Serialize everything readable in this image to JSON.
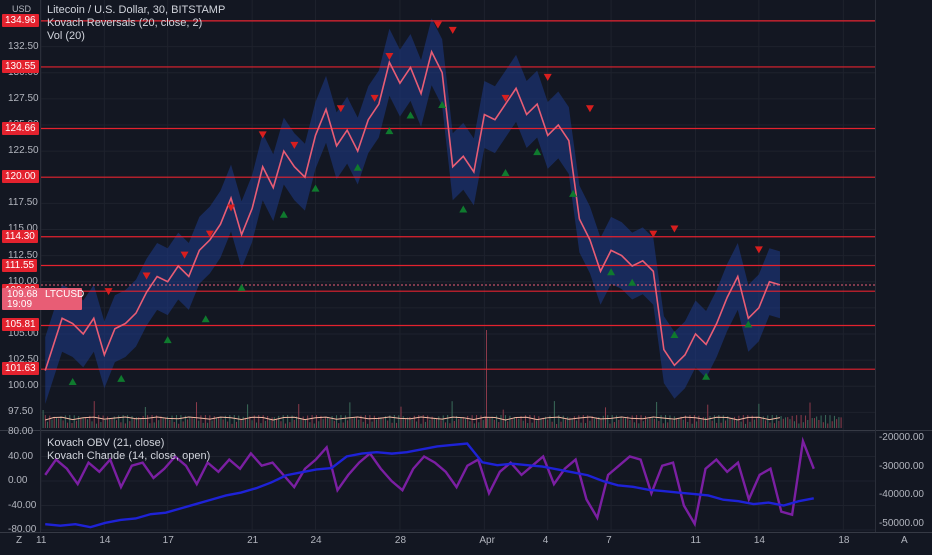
{
  "currency": "USD",
  "legend": {
    "title": "Litecoin / U.S. Dollar, 30, BITSTAMP",
    "ind1": "Kovach Reversals (20, close, 2)",
    "ind2": "Vol (20)",
    "ind3": "Kovach OBV (21, close)",
    "ind4": "Kovach Chande (14, close, open)"
  },
  "price_badge": {
    "symbol": "LTCUSD",
    "price": "109.68",
    "countdown": "19:09"
  },
  "footer": {
    "left": "Z",
    "right": "A"
  },
  "colors": {
    "background": "#131722",
    "levels": "#e3222e",
    "price_line": "#e85d75",
    "band": "#1e3a8a",
    "obv": "#1e22d6",
    "chande": "#7b1fa2",
    "up_marker": "#0f7a2e",
    "down_marker": "#d81e1e"
  },
  "chart_data": [
    {
      "type": "line",
      "title": "Litecoin / U.S. Dollar, 30, BITSTAMP",
      "ylabel": "USD",
      "ylim": [
        96.0,
        136.0
      ],
      "yticks": [
        "97.50",
        "100.00",
        "102.50",
        "105.00",
        "107.50",
        "110.00",
        "112.50",
        "115.00",
        "117.50",
        "120.00",
        "122.50",
        "125.00",
        "127.50",
        "130.00",
        "132.50",
        "135.00"
      ],
      "xticks": [
        "11",
        "14",
        "17",
        "21",
        "24",
        "28",
        "Apr",
        "4",
        "7",
        "11",
        "14",
        "18"
      ],
      "xticks_day": [
        11,
        14,
        17,
        21,
        24,
        28,
        32,
        35,
        38,
        42,
        45,
        49
      ],
      "xlim": [
        11,
        50.5
      ],
      "levels": [
        "134.96",
        "130.55",
        "124.66",
        "120.00",
        "114.30",
        "111.55",
        "109.09",
        "105.81",
        "101.63"
      ],
      "series_x": [
        11.2,
        11.6,
        12.0,
        12.5,
        13.0,
        13.5,
        14.0,
        14.5,
        15.0,
        15.5,
        16.0,
        16.5,
        17.0,
        17.5,
        18.0,
        18.5,
        19.0,
        19.5,
        20.0,
        20.5,
        21.0,
        21.5,
        22.0,
        22.5,
        23.0,
        23.5,
        24.0,
        24.5,
        25.0,
        25.5,
        26.0,
        26.5,
        27.0,
        27.5,
        28.0,
        28.5,
        29.0,
        29.5,
        30.0,
        30.5,
        31.0,
        31.5,
        32.0,
        32.5,
        33.0,
        33.5,
        34.0,
        34.5,
        35.0,
        35.5,
        36.0,
        36.5,
        37.0,
        37.5,
        38.0,
        38.5,
        39.0,
        39.5,
        40.0,
        40.5,
        41.0,
        41.5,
        42.0,
        42.5,
        43.0,
        43.5,
        44.0,
        44.5,
        45.0,
        45.5,
        46.0
      ],
      "series_y": [
        101.5,
        104.0,
        106.5,
        106.0,
        105.0,
        106.5,
        103.0,
        105.5,
        106.0,
        107.0,
        109.0,
        110.5,
        110.0,
        111.5,
        110.5,
        113.0,
        114.0,
        115.5,
        118.0,
        114.5,
        117.0,
        121.0,
        119.0,
        122.5,
        121.0,
        120.0,
        124.0,
        126.5,
        123.0,
        124.5,
        122.5,
        125.5,
        127.0,
        131.0,
        129.0,
        130.5,
        128.0,
        132.0,
        130.0,
        121.0,
        122.0,
        120.5,
        126.0,
        125.5,
        127.0,
        128.5,
        126.0,
        127.0,
        124.0,
        125.0,
        123.5,
        116.0,
        114.0,
        111.0,
        113.0,
        112.5,
        111.5,
        112.0,
        111.0,
        103.5,
        102.0,
        103.0,
        105.0,
        104.0,
        106.0,
        108.5,
        110.5,
        106.5,
        107.5,
        110.0,
        109.7
      ],
      "down_markers": [
        [
          11.8,
          108.5
        ],
        [
          14.2,
          109.0
        ],
        [
          16.0,
          110.5
        ],
        [
          17.8,
          112.5
        ],
        [
          19.0,
          114.5
        ],
        [
          20.0,
          117.0
        ],
        [
          21.5,
          124.0
        ],
        [
          23.0,
          123.0
        ],
        [
          25.2,
          126.5
        ],
        [
          26.8,
          127.5
        ],
        [
          27.5,
          131.5
        ],
        [
          29.8,
          134.5
        ],
        [
          30.5,
          134.0
        ],
        [
          33.0,
          127.5
        ],
        [
          35.0,
          129.5
        ],
        [
          37.0,
          126.5
        ],
        [
          40.0,
          114.5
        ],
        [
          41.0,
          115.0
        ],
        [
          45.0,
          113.0
        ]
      ],
      "up_markers": [
        [
          12.5,
          100.5
        ],
        [
          14.8,
          100.8
        ],
        [
          17.0,
          104.5
        ],
        [
          18.8,
          106.5
        ],
        [
          20.5,
          109.5
        ],
        [
          22.5,
          116.5
        ],
        [
          24.0,
          119.0
        ],
        [
          26.0,
          121.0
        ],
        [
          27.5,
          124.5
        ],
        [
          28.5,
          126.0
        ],
        [
          30.0,
          127.0
        ],
        [
          31.0,
          117.0
        ],
        [
          33.0,
          120.5
        ],
        [
          34.5,
          122.5
        ],
        [
          36.2,
          118.5
        ],
        [
          38.0,
          111.0
        ],
        [
          39.0,
          110.0
        ],
        [
          41.0,
          105.0
        ],
        [
          42.5,
          101.0
        ],
        [
          44.5,
          106.0
        ]
      ]
    },
    {
      "type": "line",
      "title": "Kovach Chande (14, close, open)",
      "ylim": [
        -80.0,
        80.0
      ],
      "yticks": [
        "80.00",
        "40.00",
        "0.00",
        "-40.00",
        "-80.00"
      ],
      "series": [
        {
          "name": "Kovach Chande (14, close, open)",
          "axis": "left",
          "values": [
            10,
            35,
            20,
            -5,
            30,
            15,
            35,
            -10,
            25,
            30,
            5,
            20,
            40,
            25,
            -5,
            30,
            15,
            35,
            20,
            45,
            25,
            30,
            10,
            -10,
            20,
            35,
            55,
            -15,
            10,
            30,
            45,
            20,
            0,
            -15,
            20,
            40,
            30,
            15,
            -10,
            25,
            35,
            -20,
            15,
            30,
            10,
            25,
            40,
            -5,
            20,
            35,
            -30,
            -60,
            10,
            25,
            40,
            35,
            -20,
            25,
            30,
            -40,
            -70,
            20,
            35,
            15,
            30,
            -30,
            10,
            20,
            -50,
            -55,
            65,
            20
          ]
        },
        {
          "name": "Kovach OBV (21, close)",
          "axis": "right",
          "ylim": [
            -52000,
            -18000
          ],
          "yticks": [
            "-20000.00",
            "-30000.00",
            "-40000.00",
            "-50000.00"
          ],
          "values": [
            -50000,
            -50500,
            -50000,
            -51000,
            -49500,
            -48500,
            -48000,
            -46500,
            -46000,
            -44500,
            -43000,
            -41500,
            -40000,
            -39000,
            -37500,
            -35500,
            -33000,
            -32000,
            -31000,
            -30500,
            -26500,
            -25500,
            -25000,
            -25500,
            -25000,
            -24000,
            -23000,
            -22500,
            -22000,
            -28500,
            -29500,
            -29000,
            -29500,
            -30000,
            -31000,
            -32000,
            -33000,
            -35000,
            -36500,
            -37000,
            -38000,
            -38500,
            -39000,
            -39500,
            -40000,
            -41500,
            -42000,
            -43000,
            -42500,
            -43500,
            -42000,
            -41000
          ]
        }
      ]
    }
  ]
}
